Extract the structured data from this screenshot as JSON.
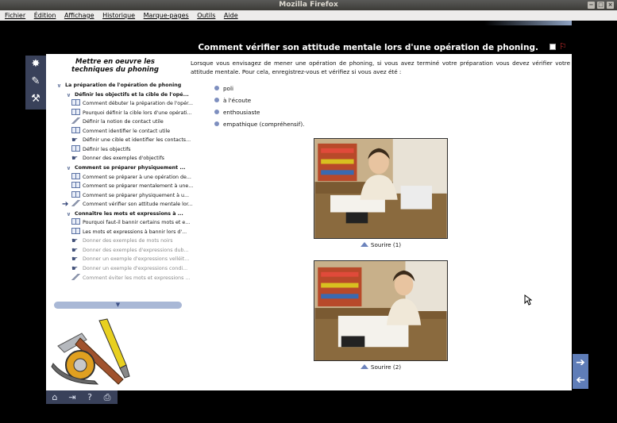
{
  "window": {
    "title": "Mozilla Firefox",
    "controls": [
      "−",
      "□",
      "×"
    ]
  },
  "menu": [
    "Fichier",
    "Édition",
    "Affichage",
    "Historique",
    "Marque-pages",
    "Outils",
    "Aide"
  ],
  "page": {
    "title": "Comment vérifier son attitude mentale lors d'une opération de phoning.",
    "tree_title": "Mettre en oeuvre les techniques du phoning",
    "intro": "Lorsque vous envisagez de mener une opération de phoning, si vous avez terminé votre préparation vous devez vérifier votre attitude mentale. Pour cela, enregistrez-vous et vérifiez si vous avez été :",
    "bullets": [
      "poli",
      "à l'écoute",
      "enthousiaste",
      "empathique (compréhensif)."
    ],
    "photo_captions": [
      "Sourire (1)",
      "Sourire (2)"
    ]
  },
  "tree": [
    {
      "label": "La préparation de l'opération de phoning",
      "level": 0,
      "type": "chevron",
      "bold": true
    },
    {
      "label": "Définir les objectifs et la cible de l'opé...",
      "level": 1,
      "type": "chevron",
      "bold": true
    },
    {
      "label": "Comment débuter la préparation de l'opér...",
      "level": 2,
      "type": "book"
    },
    {
      "label": "Pourquoi définir la cible lors d'une opérati...",
      "level": 2,
      "type": "book"
    },
    {
      "label": "Définir la notion de contact utile",
      "level": 2,
      "type": "pencil"
    },
    {
      "label": "Comment identifier le contact utile",
      "level": 2,
      "type": "book"
    },
    {
      "label": "Définir une cible et identifier les contacts...",
      "level": 2,
      "type": "pointer"
    },
    {
      "label": "Définir les objectifs",
      "level": 2,
      "type": "book"
    },
    {
      "label": "Donner des exemples d'objectifs",
      "level": 2,
      "type": "pointer"
    },
    {
      "label": "Comment se préparer physiquement ...",
      "level": 1,
      "type": "chevron",
      "bold": true
    },
    {
      "label": "Comment se préparer à une opération de...",
      "level": 2,
      "type": "book"
    },
    {
      "label": "Comment se préparer mentalement à une...",
      "level": 2,
      "type": "book"
    },
    {
      "label": "Comment se préparer physiquement à u...",
      "level": 2,
      "type": "book"
    },
    {
      "label": "Comment vérifier son attitude mentale lor...",
      "level": 2,
      "type": "pencil",
      "current": true
    },
    {
      "label": "Connaître les mots et expressions à ...",
      "level": 1,
      "type": "chevron",
      "bold": true
    },
    {
      "label": "Pourquoi faut-il bannir certains mots et e...",
      "level": 2,
      "type": "book"
    },
    {
      "label": "Les mots et expressions à bannir lors d'...",
      "level": 2,
      "type": "book"
    },
    {
      "label": "Donner des exemples de mots noirs",
      "level": 2,
      "type": "pointer",
      "grey": true
    },
    {
      "label": "Donner des exemples d'expressions dub...",
      "level": 2,
      "type": "pointer",
      "grey": true
    },
    {
      "label": "Donner un exemple d'expressions velléit...",
      "level": 2,
      "type": "pointer",
      "grey": true
    },
    {
      "label": "Donner un exemple d'expressions condi...",
      "level": 2,
      "type": "pointer",
      "grey": true
    },
    {
      "label": "Comment éviter les mots et expressions ...",
      "level": 2,
      "type": "pencil",
      "grey": true
    }
  ],
  "icons": {
    "left_strip": [
      "compass-star-icon",
      "pencil-tool-icon",
      "tools-icon"
    ],
    "bottom_toolbar": [
      "home-icon",
      "exit-icon",
      "help-icon",
      "print-icon"
    ],
    "right_nav": [
      "next-arrow-icon",
      "previous-arrow-icon"
    ]
  },
  "colors": {
    "accent": "#5f7db8",
    "panel_dark": "#39415a",
    "bullet": "#7e8fbf"
  }
}
